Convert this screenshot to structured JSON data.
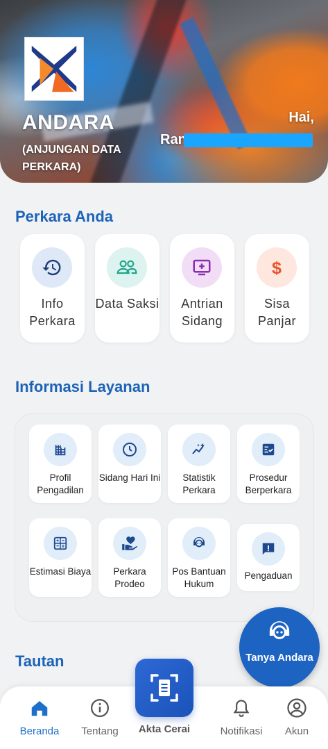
{
  "header": {
    "brand": "ANDARA",
    "subtitle": "(ANJUNGAN DATA PERKARA)",
    "greeting": "Hai,",
    "user_prefix": "Ran"
  },
  "perkara_anda": {
    "title": "Perkara Anda",
    "items": [
      {
        "label": "Info Perkara",
        "icon": "history-icon",
        "color": "#1d63c2",
        "bg": "#dfe8f7"
      },
      {
        "label": "Data Saksi",
        "icon": "people-icon",
        "color": "#20a58c",
        "bg": "#dcf3ef"
      },
      {
        "label": "Antrian Sidang",
        "icon": "queue-screen-icon",
        "color": "#8a2fb0",
        "bg": "#f1def6"
      },
      {
        "label": "Sisa Panjar",
        "icon": "dollar-icon",
        "color": "#e8542b",
        "bg": "#fde7df"
      }
    ]
  },
  "informasi_layanan": {
    "title": "Informasi Layanan",
    "items": [
      {
        "label": "Profil Pengadilan",
        "icon": "building-icon"
      },
      {
        "label": "Sidang Hari Ini",
        "icon": "clock-icon"
      },
      {
        "label": "Statistik Perkara",
        "icon": "trend-icon"
      },
      {
        "label": "Prosedur Berperkara",
        "icon": "checklist-icon"
      },
      {
        "label": "Estimasi Biaya",
        "icon": "calculator-icon"
      },
      {
        "label": "Perkara Prodeo",
        "icon": "hand-heart-icon"
      },
      {
        "label": "Pos Bantuan Hukum",
        "icon": "support-agent-icon"
      },
      {
        "label": "Pengaduan",
        "icon": "report-icon"
      }
    ]
  },
  "tautan": {
    "title": "Tautan"
  },
  "fab": {
    "label": "Tanya Andara"
  },
  "nav": {
    "items": [
      {
        "label": "Beranda",
        "icon": "home-icon",
        "active": true
      },
      {
        "label": "Tentang",
        "icon": "info-icon",
        "active": false
      },
      {
        "label": "Akta Cerai",
        "icon": "document-scan-icon",
        "active": false
      },
      {
        "label": "Notifikasi",
        "icon": "bell-icon",
        "active": false
      },
      {
        "label": "Akun",
        "icon": "account-icon",
        "active": false
      }
    ]
  },
  "colors": {
    "primary": "#1d63c2",
    "active_nav": "#1d70c9"
  }
}
